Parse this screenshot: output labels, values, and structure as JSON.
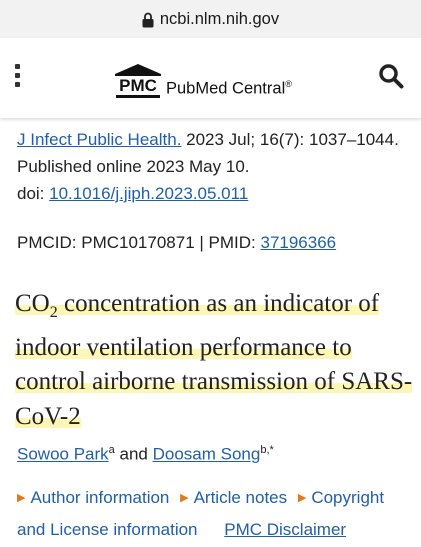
{
  "browser": {
    "url": "ncbi.nlm.nih.gov"
  },
  "header": {
    "logo_abbr": "PMC",
    "logo_name": "PubMed Central",
    "logo_mark": "®"
  },
  "citation": {
    "journal": "J Infect Public Health.",
    "details": " 2023 Jul; 16(7): 1037–1044.  Published online 2023 May 10.",
    "doi_label": "doi: ",
    "doi": "10.1016/j.jiph.2023.05.011"
  },
  "ids": {
    "pmcid_label": "PMCID: ",
    "pmcid": "PMC10170871",
    "sep": " | ",
    "pmid_label": "PMID: ",
    "pmid": "37196366"
  },
  "article": {
    "title_prefix": "CO",
    "title_sub": "2",
    "title_rest": " concentration as an indicator of indoor ventilation performance to control airborne transmission of SARS-CoV-2"
  },
  "authors": {
    "author1": "Sowoo Park",
    "author1_sup": "a",
    "and": " and ",
    "author2": "Doosam Song",
    "author2_sup": "b,*"
  },
  "links": {
    "author_info": "Author information",
    "article_notes": "Article notes",
    "copyright": "Copyright and License information",
    "disclaimer": "PMC Disclaimer"
  },
  "colors": {
    "link": "#2160a8",
    "highlight": "#fdf6b5",
    "arrow": "#e07a1f"
  }
}
